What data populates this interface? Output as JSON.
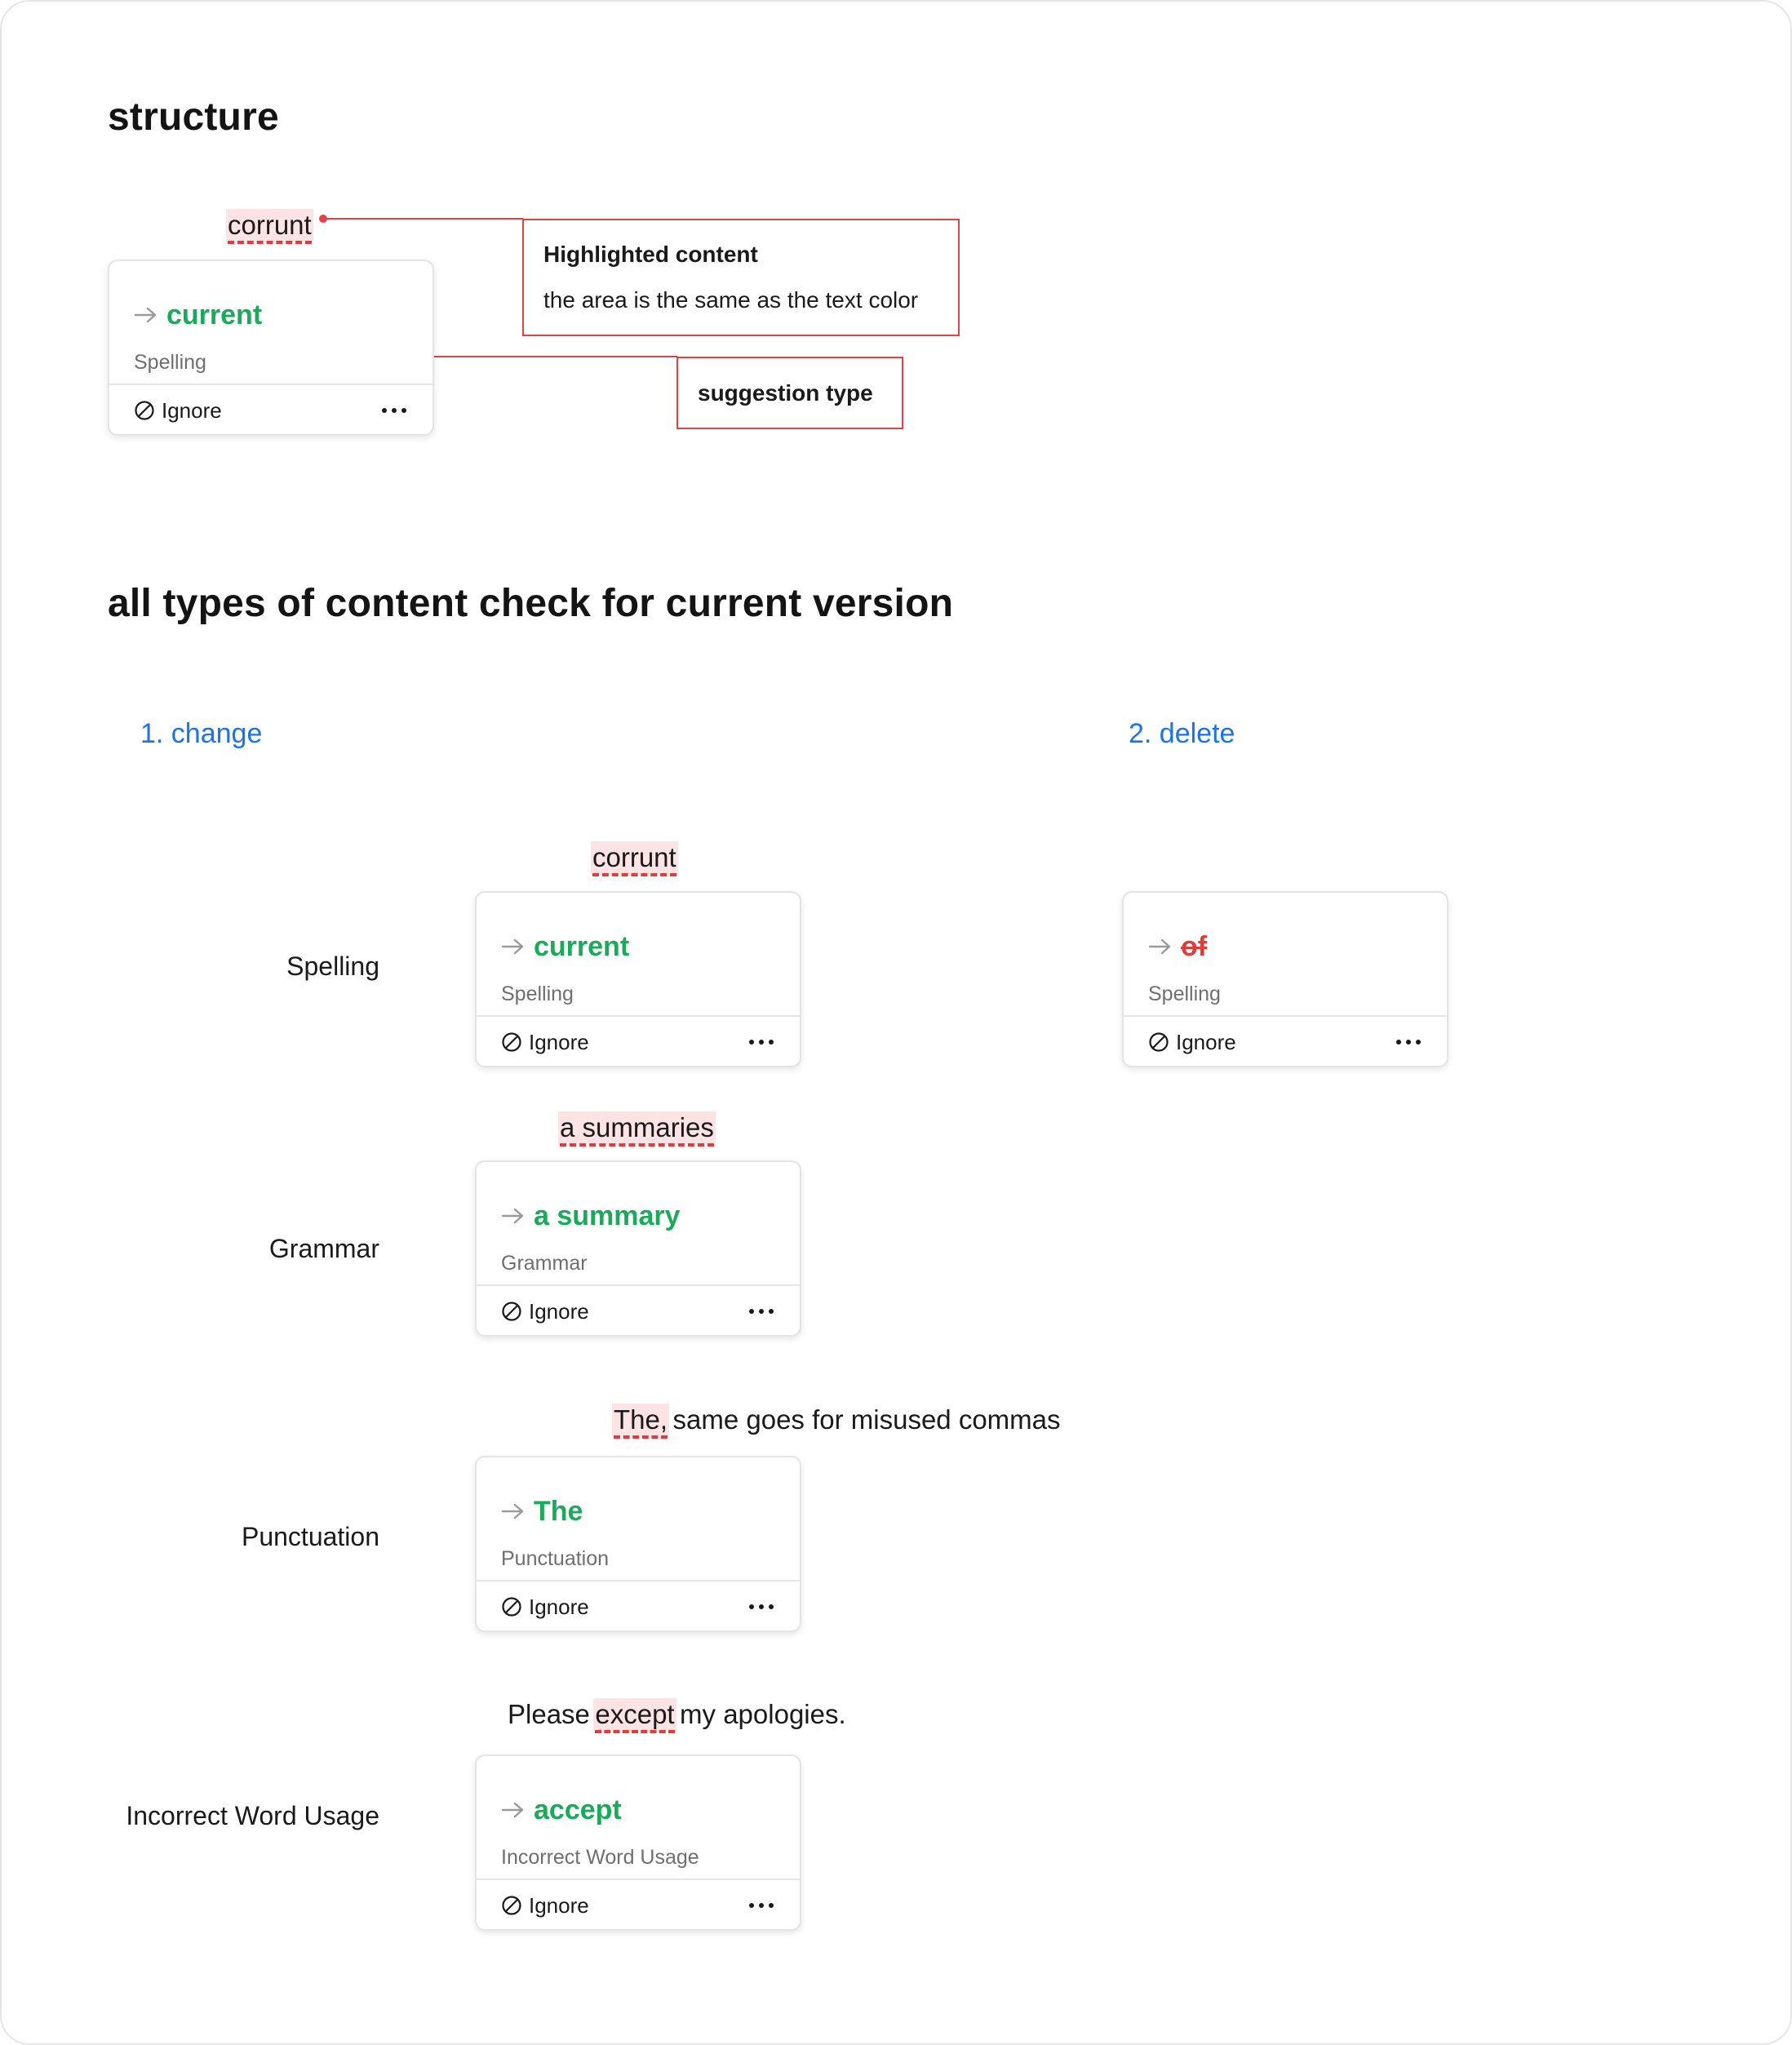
{
  "structure": {
    "heading": "structure",
    "highlight_word": "corrunt",
    "card": {
      "suggestion": "current",
      "type": "Spelling",
      "ignore": "Ignore"
    },
    "callout_highlight": {
      "title": "Highlighted content",
      "desc": "the area is the same as the text color"
    },
    "callout_type": {
      "title": "suggestion type"
    }
  },
  "section2": {
    "heading": "all types of content check for current version",
    "col_change": "1. change",
    "col_delete": "2. delete"
  },
  "rows": {
    "spelling": {
      "label": "Spelling",
      "highlight": "corrunt",
      "card": {
        "suggestion": "current",
        "type": "Spelling",
        "ignore": "Ignore"
      },
      "delete_card": {
        "suggestion": "of",
        "type": "Spelling",
        "ignore": "Ignore"
      }
    },
    "grammar": {
      "label": "Grammar",
      "highlight": "a summaries",
      "card": {
        "suggestion": "a summary",
        "type": "Grammar",
        "ignore": "Ignore"
      }
    },
    "punctuation": {
      "label": "Punctuation",
      "highlight": "The,",
      "rest": "same goes for misused commas",
      "card": {
        "suggestion": "The",
        "type": "Punctuation",
        "ignore": "Ignore"
      }
    },
    "word_usage": {
      "label": "Incorrect Word Usage",
      "before": "Please",
      "highlight": "except",
      "after": "my apologies.",
      "card": {
        "suggestion": "accept",
        "type": "Incorrect Word Usage",
        "ignore": "Ignore"
      }
    }
  },
  "colors": {
    "suggestion_green": "#1aab5a",
    "delete_red": "#e03c3c",
    "highlight_bg": "#fde3e3",
    "callout_border": "#e24242",
    "link_blue": "#1a73e8"
  },
  "icons": [
    "arrow-right-icon",
    "ignore-icon",
    "more-icon"
  ]
}
